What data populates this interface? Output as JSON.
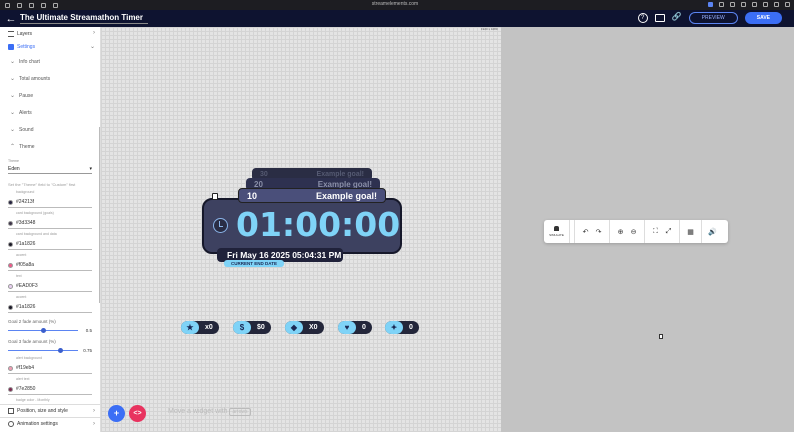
{
  "browser": {
    "url": "streamelements.com"
  },
  "app": {
    "title": "The Ultimate Streamathon Timer",
    "preview_label": "PREVIEW",
    "save_label": "SAVE"
  },
  "sidebar": {
    "layers_label": "Layers",
    "settings_label": "Settings",
    "sections": [
      "Info chart",
      "Total amounts",
      "Pause",
      "Alerts",
      "Sound",
      "Theme"
    ],
    "theme_label": "Theme",
    "theme_value": "Eden",
    "hint": "Set the \"Theme\" field to \"Custom\" first",
    "colors": [
      {
        "label": "background",
        "hex": "#24213f",
        "swatch": "#24213f"
      },
      {
        "label": "card background (goals)",
        "hex": "#3d3348",
        "swatch": "#3d3348"
      },
      {
        "label": "card background and data",
        "hex": "#1a1826",
        "swatch": "#1a1826"
      },
      {
        "label": "accent",
        "hex": "#f05a8a",
        "swatch": "#f05a8a"
      },
      {
        "label": "text",
        "hex": "#EAD0F3",
        "swatch": "#EAD0F3"
      },
      {
        "label": "accent",
        "hex": "#1a1826",
        "swatch": "#1a1826"
      }
    ],
    "goal2_label": "Goal 2 fade amount (%)",
    "goal2_value": "0.5",
    "goal2_fraction": 0.5,
    "goal3_label": "Goal 3 fade amount (%)",
    "goal3_value": "0.75",
    "goal3_fraction": 0.75,
    "colors2": [
      {
        "label": "alert background",
        "hex": "#f19eb4",
        "swatch": "#f19eb4"
      },
      {
        "label": "alert text",
        "hex": "#7e2850",
        "swatch": "#7e2850"
      },
      {
        "label": "badge color - Monthly",
        "hex": "#f19eb4",
        "swatch": "#f19eb4"
      }
    ],
    "position_label": "Position, size and style",
    "animation_label": "Animation settings"
  },
  "canvas": {
    "dimensions": "1920 x 1080",
    "goals": [
      {
        "num": "30",
        "label": "Example goal!"
      },
      {
        "num": "20",
        "label": "Example goal!"
      },
      {
        "num": "10",
        "label": "Example goal!"
      }
    ],
    "timer": "01:00:00",
    "end_date": "Fri May 16 2025 05:04:31 PM",
    "end_date_label": "CURRENT END DATE",
    "counters": [
      {
        "icon": "★",
        "value": "x0",
        "name": "star-icon"
      },
      {
        "icon": "$",
        "value": "$0",
        "name": "dollar-icon"
      },
      {
        "icon": "◆",
        "value": "X0",
        "name": "bits-icon"
      },
      {
        "icon": "♥",
        "value": "0",
        "name": "heart-icon"
      },
      {
        "icon": "✦",
        "value": "0",
        "name": "megaphone-icon"
      }
    ],
    "move_hint": "Move a widget with",
    "move_key": "arrows"
  },
  "toolbox": {
    "simulate_label": "SIMULATE"
  }
}
